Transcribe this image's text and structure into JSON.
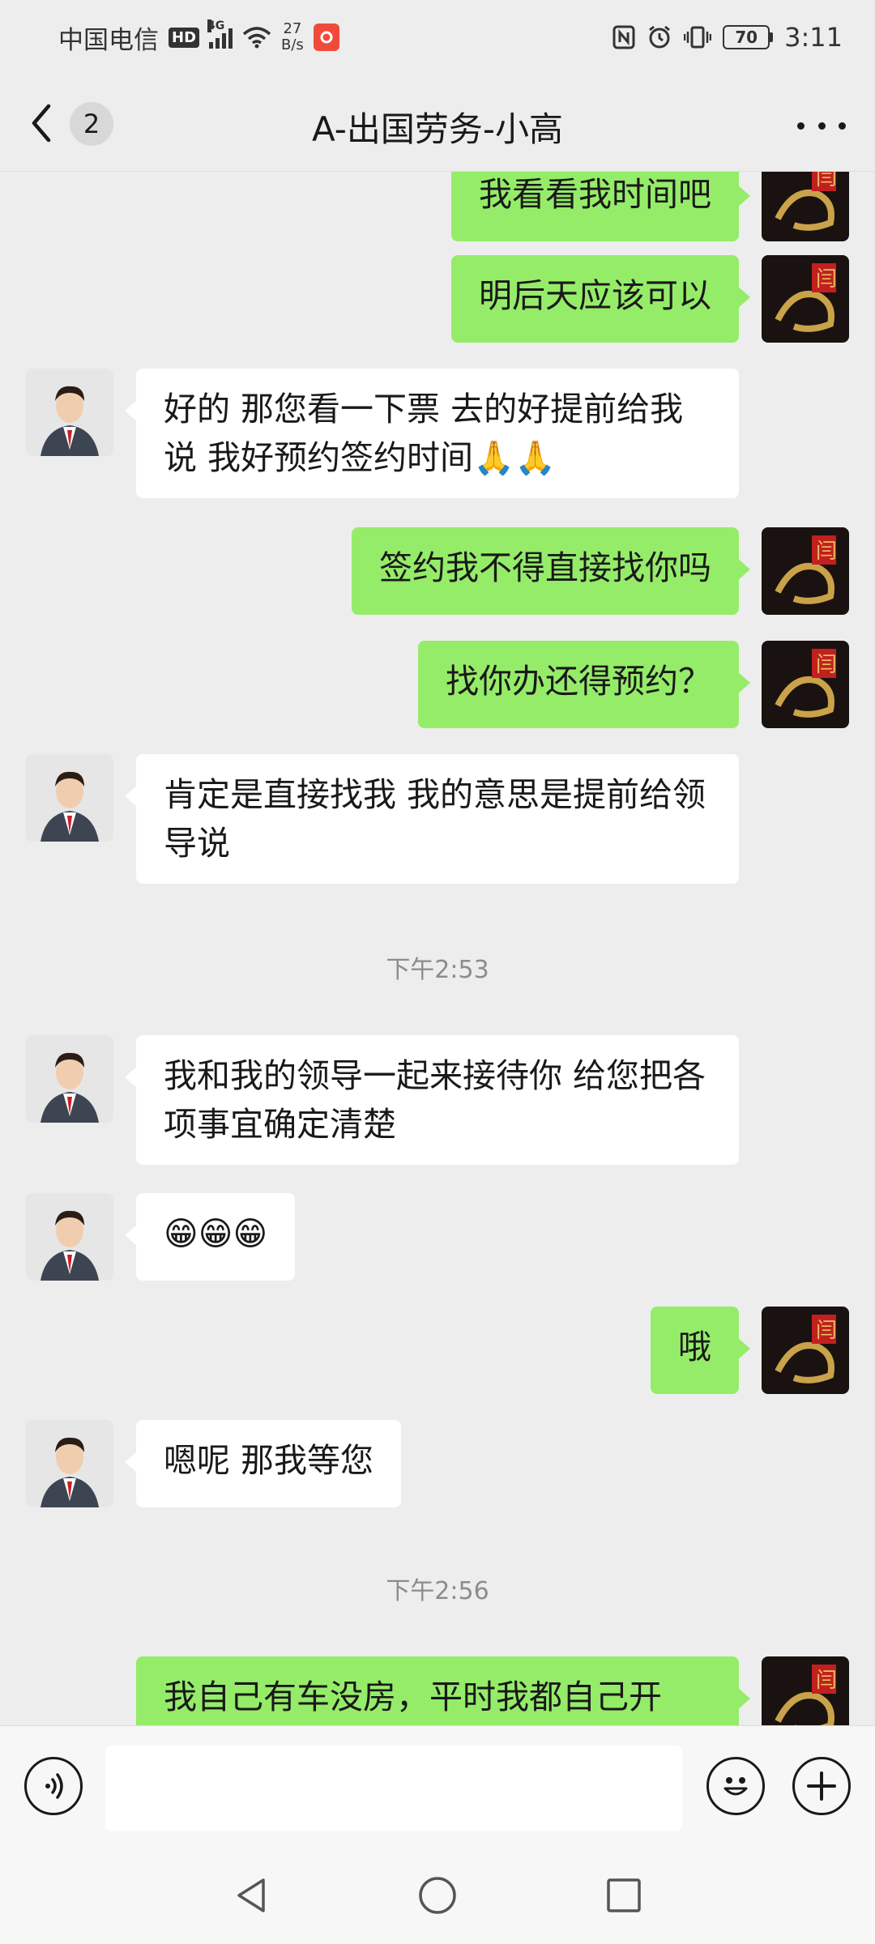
{
  "status_bar": {
    "carrier": "中国电信",
    "hd": "HD",
    "network": "4G",
    "speed_value": "27",
    "speed_unit": "B/s",
    "battery": "70",
    "time": "3:11"
  },
  "header": {
    "unread_count": "2",
    "title": "A-出国劳务-小高"
  },
  "messages": [
    {
      "side": "right",
      "text": "我看看我时间吧"
    },
    {
      "side": "right",
      "text": "明后天应该可以"
    },
    {
      "side": "left",
      "text": "好的 那您看一下票 去的好提前给我说 我好预约签约时间🙏🙏"
    },
    {
      "side": "right",
      "text": "签约我不得直接找你吗"
    },
    {
      "side": "right",
      "text": "找你办还得预约？"
    },
    {
      "side": "left",
      "text": "肯定是直接找我 我的意思是提前给领导说"
    },
    {
      "type": "time",
      "text": "下午2:53"
    },
    {
      "side": "left",
      "text": "我和我的领导一起来接待你 给您把各项事宜确定清楚"
    },
    {
      "side": "left",
      "text": "😁😁😁"
    },
    {
      "side": "right",
      "text": "哦"
    },
    {
      "side": "left",
      "text": "嗯呢 那我等您"
    },
    {
      "type": "time",
      "text": "下午2:56"
    },
    {
      "side": "right",
      "text": "我自己有车没房，平时我都自己开"
    }
  ],
  "input": {
    "value": ""
  },
  "icons": {
    "back": "back-arrow-icon",
    "more": "more-dots-icon",
    "voice": "voice-icon",
    "emoji": "emoji-icon",
    "plus": "plus-icon",
    "nav_back": "nav-back-icon",
    "nav_home": "nav-home-icon",
    "nav_recent": "nav-recent-icon"
  },
  "colors": {
    "sent_bubble": "#95ec69",
    "received_bubble": "#ffffff",
    "background": "#ededed"
  }
}
